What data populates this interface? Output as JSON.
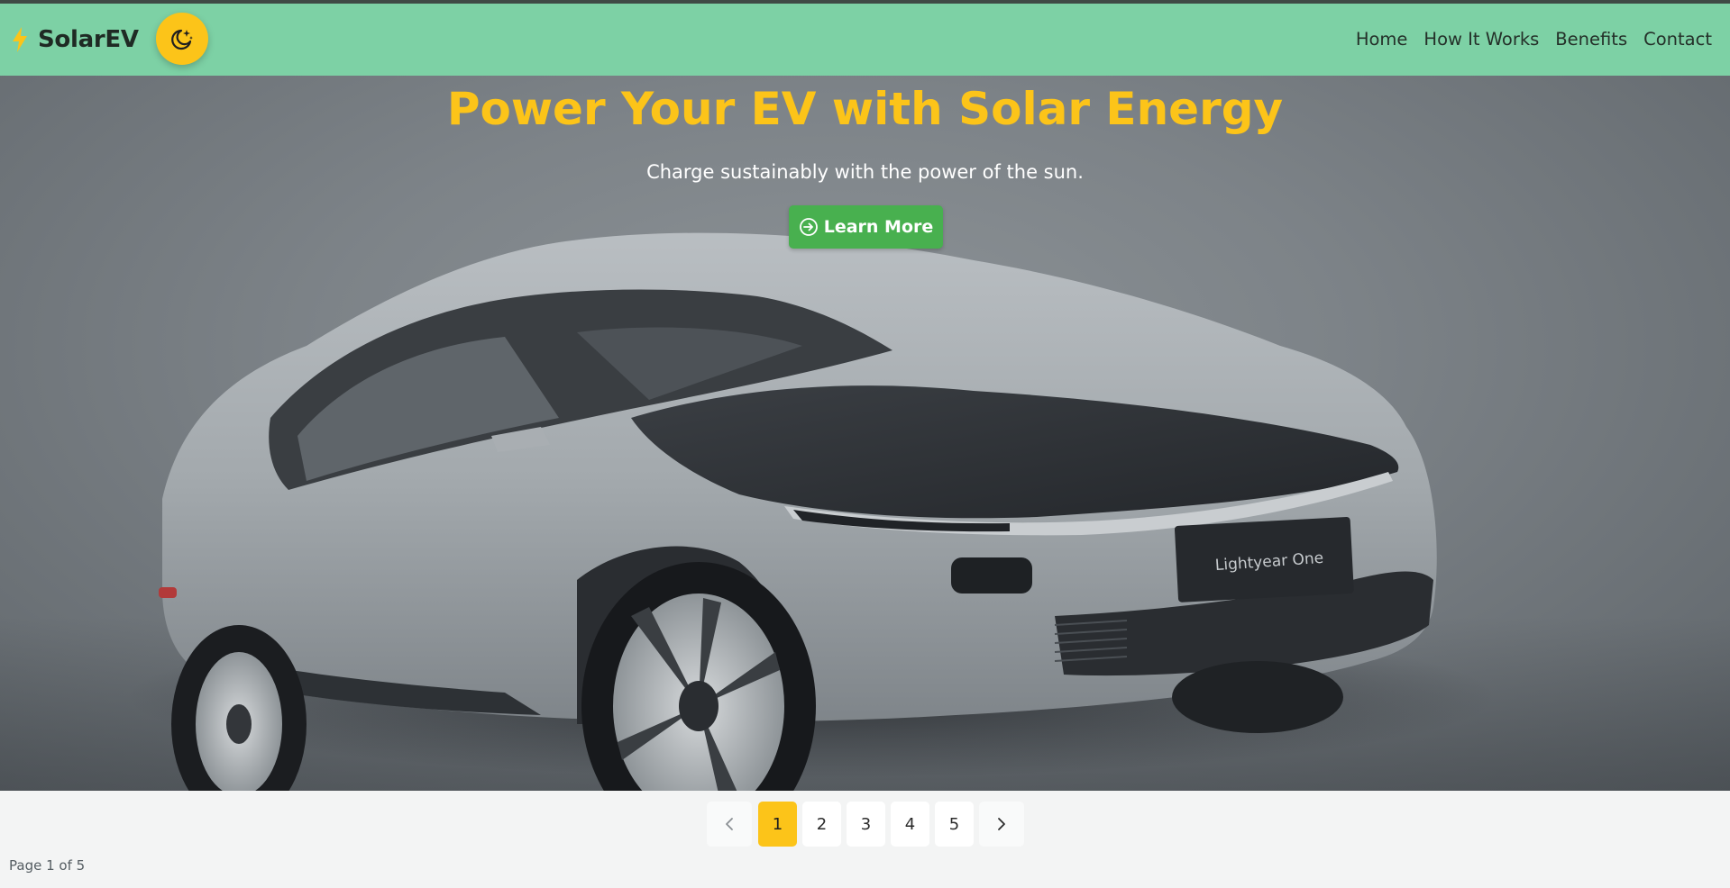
{
  "brand": {
    "name": "SolarEV",
    "icon": "lightning-bolt-icon",
    "color": "#fcc419"
  },
  "theme_toggle": {
    "icon": "moon-stars-icon"
  },
  "nav": {
    "items": [
      {
        "label": "Home"
      },
      {
        "label": "How It Works"
      },
      {
        "label": "Benefits"
      },
      {
        "label": "Contact"
      }
    ]
  },
  "hero": {
    "title": "Power Your EV with Solar Energy",
    "subtitle": "Charge sustainably with the power of the sun.",
    "cta_label": "Learn More",
    "cta_icon": "arrow-right-circle-icon",
    "car_plate_text": "Lightyear One"
  },
  "pagination": {
    "prev_icon": "chevron-left-icon",
    "next_icon": "chevron-right-icon",
    "pages": [
      "1",
      "2",
      "3",
      "4",
      "5"
    ],
    "current": "1",
    "status": "Page 1 of 5"
  },
  "colors": {
    "navbar": "#7dd1a5",
    "accent": "#fcc419",
    "cta": "#48b04f"
  }
}
